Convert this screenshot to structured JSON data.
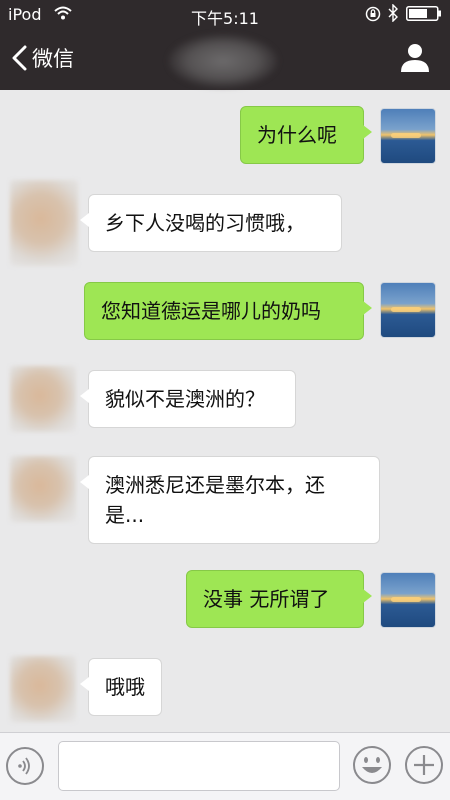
{
  "status_bar": {
    "carrier": "iPod",
    "time": "下午5:11"
  },
  "nav": {
    "back_label": "微信",
    "icons": {
      "back": "chevron-left-icon",
      "profile": "person-icon"
    }
  },
  "messages": [
    {
      "side": "self",
      "text": "为什么呢"
    },
    {
      "side": "other",
      "text": "乡下人没喝的习惯哦，"
    },
    {
      "side": "self",
      "text": "您知道德运是哪儿的奶吗"
    },
    {
      "side": "other",
      "text": "貌似不是澳洲的？"
    },
    {
      "side": "other",
      "text": "澳洲悉尼还是墨尔本，还是..."
    },
    {
      "side": "self",
      "text": "没事 无所谓了"
    },
    {
      "side": "other",
      "text": "哦哦"
    }
  ],
  "input_bar": {
    "value": "",
    "icons": {
      "voice": "voice-icon",
      "emoji": "emoji-icon",
      "plus": "plus-icon"
    }
  },
  "colors": {
    "header_bg": "#2f2a2c",
    "chat_bg": "#e9e9ea",
    "self_bubble": "#9ee654",
    "other_bubble": "#ffffff"
  }
}
